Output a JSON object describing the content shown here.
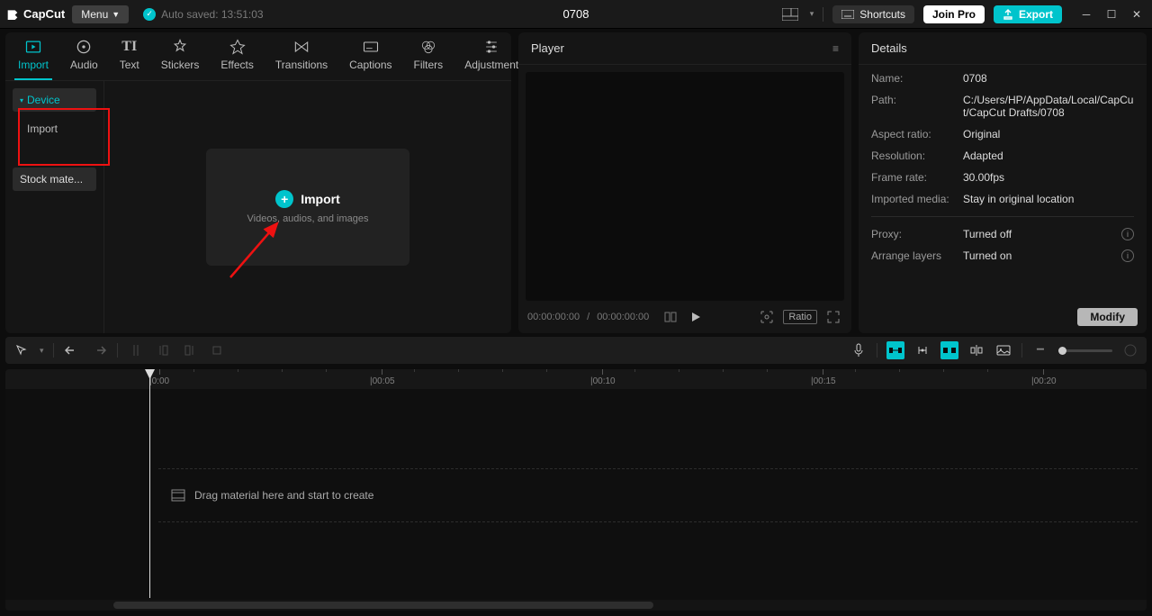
{
  "app": {
    "name": "CapCut"
  },
  "menu": {
    "label": "Menu"
  },
  "autosave": {
    "text": "Auto saved: 13:51:03"
  },
  "project": {
    "title": "0708"
  },
  "titlebar": {
    "shortcuts": "Shortcuts",
    "joinpro": "Join Pro",
    "export": "Export"
  },
  "toolTabs": [
    {
      "label": "Import"
    },
    {
      "label": "Audio"
    },
    {
      "label": "Text"
    },
    {
      "label": "Stickers"
    },
    {
      "label": "Effects"
    },
    {
      "label": "Transitions"
    },
    {
      "label": "Captions"
    },
    {
      "label": "Filters"
    },
    {
      "label": "Adjustment"
    }
  ],
  "sidebar": {
    "device": "Device",
    "import": "Import",
    "stock": "Stock mate..."
  },
  "importCard": {
    "title": "Import",
    "subtitle": "Videos, audios, and images"
  },
  "player": {
    "title": "Player",
    "cur": "00:00:00:00",
    "dur": "00:00:00:00",
    "ratio": "Ratio"
  },
  "details": {
    "title": "Details",
    "name_lbl": "Name:",
    "name_val": "0708",
    "path_lbl": "Path:",
    "path_val": "C:/Users/HP/AppData/Local/CapCut/CapCut Drafts/0708",
    "aspect_lbl": "Aspect ratio:",
    "aspect_val": "Original",
    "res_lbl": "Resolution:",
    "res_val": "Adapted",
    "fps_lbl": "Frame rate:",
    "fps_val": "30.00fps",
    "impmedia_lbl": "Imported media:",
    "impmedia_val": "Stay in original location",
    "proxy_lbl": "Proxy:",
    "proxy_val": "Turned off",
    "layers_lbl": "Arrange layers",
    "layers_val": "Turned on",
    "modify": "Modify"
  },
  "ruler": [
    {
      "label": "|0:00",
      "pos": 160
    },
    {
      "label": "|00:05",
      "pos": 405
    },
    {
      "label": "|00:10",
      "pos": 650
    },
    {
      "label": "|00:15",
      "pos": 895
    },
    {
      "label": "|00:20",
      "pos": 1140
    }
  ],
  "timeline": {
    "hint": "Drag material here and start to create"
  }
}
